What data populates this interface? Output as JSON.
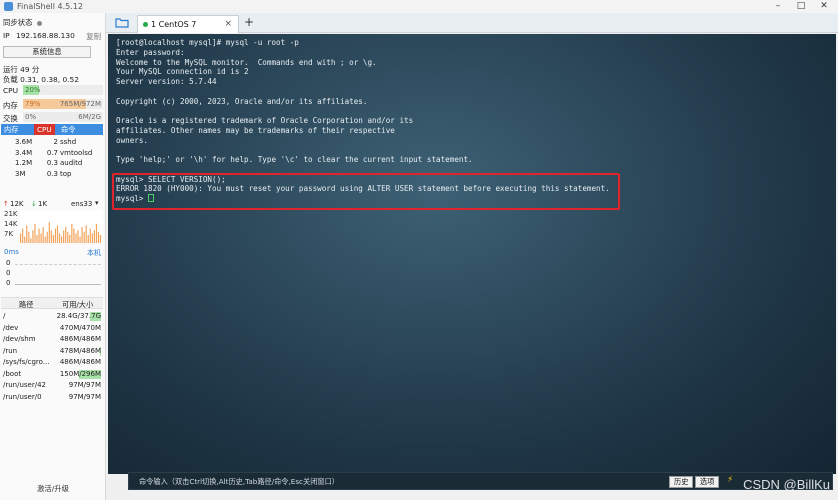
{
  "app": {
    "title": "FinalShell 4.5.12"
  },
  "window_controls": {
    "minimize": "–",
    "maximize": "□",
    "close": "✕"
  },
  "sidebar": {
    "sync_status": "同步状态",
    "ip_label": "IP",
    "ip": "192.168.88.130",
    "copy": "复制",
    "sysinfo_button": "系统信息",
    "uptime": "运行 49 分",
    "load": "负载 0.31, 0.38, 0.52",
    "cpu": {
      "label": "CPU",
      "pct_text": "20%",
      "fraction": 0.2
    },
    "mem": {
      "label": "内存",
      "pct_text": "79%",
      "amount": "765M/972M",
      "fraction": 0.79
    },
    "swap": {
      "label": "交换",
      "pct_text": "0%",
      "amount": "6M/2G",
      "fraction": 0.0
    },
    "process_headers": [
      "内存",
      "CPU",
      "命令"
    ],
    "processes": [
      {
        "mem": "3.6M",
        "cpu": "2",
        "cmd": "sshd"
      },
      {
        "mem": "3.4M",
        "cpu": "0.7",
        "cmd": "vmtoolsd"
      },
      {
        "mem": "1.2M",
        "cpu": "0.3",
        "cmd": "auditd"
      },
      {
        "mem": "3M",
        "cpu": "0.3",
        "cmd": "top"
      }
    ],
    "net": {
      "up": "12K",
      "down": "1K",
      "iface": "ens33",
      "scale": [
        "21K",
        "14K",
        "7K"
      ]
    },
    "ping": {
      "latency": "0ms",
      "host": "本机",
      "values": [
        "0",
        "0",
        "0"
      ]
    },
    "disk_headers": [
      "路径",
      "可用/大小"
    ],
    "disks": [
      {
        "path": "/",
        "size": "28.4G/37.7G",
        "used": 0.25
      },
      {
        "path": "/dev",
        "size": "470M/470M",
        "used": 0.0
      },
      {
        "path": "/dev/shm",
        "size": "486M/486M",
        "used": 0.0
      },
      {
        "path": "/run",
        "size": "478M/486M",
        "used": 0.02
      },
      {
        "path": "/sys/fs/cgro...",
        "size": "486M/486M",
        "used": 0.0
      },
      {
        "path": "/boot",
        "size": "150M/296M",
        "used": 0.49
      },
      {
        "path": "/run/user/42",
        "size": "97M/97M",
        "used": 0.0
      },
      {
        "path": "/run/user/0",
        "size": "97M/97M",
        "used": 0.0
      }
    ],
    "upgrade": "激活/升级"
  },
  "tabs": [
    {
      "label": "1 CentOS 7",
      "close": "×"
    }
  ],
  "tab_add": "+",
  "terminal": {
    "lines": [
      "[root@localhost mysql]# mysql -u root -p",
      "Enter password:",
      "Welcome to the MySQL monitor.  Commands end with ; or \\g.",
      "Your MySQL connection id is 2",
      "Server version: 5.7.44",
      "",
      "Copyright (c) 2000, 2023, Oracle and/or its affiliates.",
      "",
      "Oracle is a registered trademark of Oracle Corporation and/or its",
      "affiliates. Other names may be trademarks of their respective",
      "owners.",
      "",
      "Type 'help;' or '\\h' for help. Type '\\c' to clear the current input statement.",
      "",
      "mysql> SELECT VERSION();",
      "ERROR 1820 (HY000): You must reset your password using ALTER USER statement before executing this statement.",
      "mysql> "
    ]
  },
  "cmdbar": {
    "hint": "命令输入（双击Ctrl切换,Alt历史,Tab路径/命令,Esc关闭窗口）",
    "history": "历史",
    "options": "选项"
  },
  "watermark": "CSDN @BillKu",
  "colors": {
    "mem_fill": "#f6c99a",
    "cpu_fill": "#a9e2a9",
    "disk_fill": "#a9e2a9",
    "highlight": "#e0242c"
  }
}
